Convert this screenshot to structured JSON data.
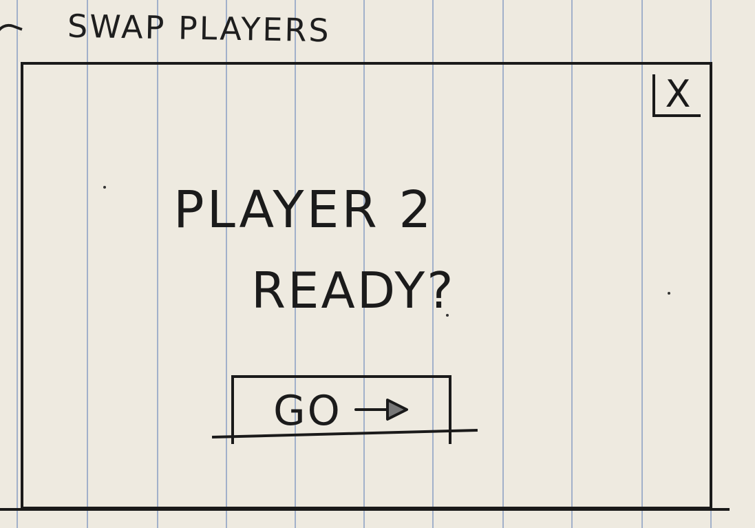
{
  "sheet_title": "SWAP PLAYERS",
  "dialog": {
    "close_label": "X",
    "prompt_line1": "PLAYER 2",
    "prompt_line2": "READY?",
    "go_button_label": "GO"
  },
  "icons": {
    "close": "close-icon",
    "arrow": "arrow-right-icon"
  },
  "colors": {
    "paper": "#eeeae0",
    "rule_lines": "#93a6c6",
    "ink": "#1a1a1a"
  }
}
